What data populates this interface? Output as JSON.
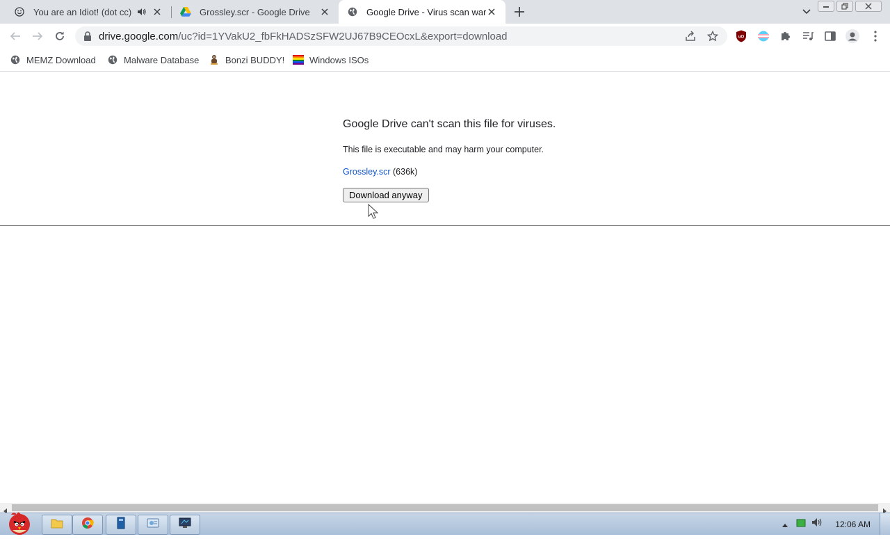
{
  "tabs": [
    {
      "title": "You are an Idiot! (dot cc)",
      "favicon": "smiley-icon",
      "muted_audio": true,
      "active": false
    },
    {
      "title": "Grossley.scr - Google Drive",
      "favicon": "google-drive-icon",
      "active": false
    },
    {
      "title": "Google Drive - Virus scan warning",
      "favicon": "globe-icon",
      "active": true
    }
  ],
  "toolbar": {
    "url_host": "drive.google.com",
    "url_path": "/uc?id=1YVakU2_fbFkHADSzSFW2UJ67B9CEOcxL&export=download"
  },
  "bookmarks": [
    {
      "label": "MEMZ Download",
      "icon": "globe-icon"
    },
    {
      "label": "Malware Database",
      "icon": "globe-icon"
    },
    {
      "label": "Bonzi BUDDY!",
      "icon": "bonzi-icon"
    },
    {
      "label": "Windows ISOs",
      "icon": "rainbow-flag-icon"
    }
  ],
  "page": {
    "heading": "Google Drive can't scan this file for viruses.",
    "warning": "This file is executable and may harm your computer.",
    "file_name": "Grossley.scr",
    "file_size": "(636k)",
    "download_button": "Download anyway"
  },
  "taskbar": {
    "clock": "12:06 AM"
  },
  "colors": {
    "tabstrip_bg": "#dee1e6",
    "link": "#1155cc",
    "taskbar": "#b9cbe0"
  }
}
